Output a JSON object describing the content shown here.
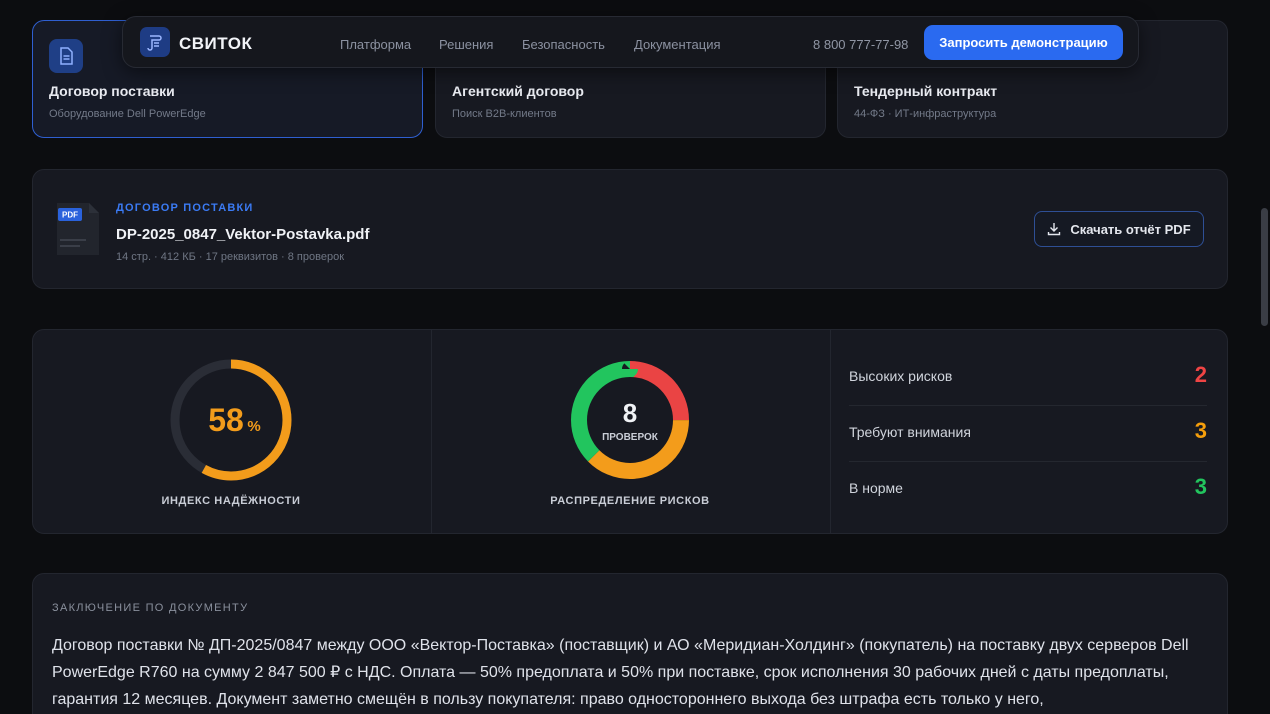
{
  "nav": {
    "brand": "СВИТОК",
    "links": [
      "Платформа",
      "Решения",
      "Безопасность",
      "Документация"
    ],
    "phone": "8 800 777-77-98",
    "cta": "Запросить демонстрацию"
  },
  "contract_tabs": [
    {
      "title": "Договор поставки",
      "subtitle": "Оборудование Dell PowerEdge",
      "active": true
    },
    {
      "title": "Агентский договор",
      "subtitle": "Поиск B2B-клиентов",
      "active": false
    },
    {
      "title": "Тендерный контракт",
      "subtitle": "44-ФЗ · ИТ-инфраструктура",
      "active": false
    }
  ],
  "file": {
    "badge": "PDF",
    "category": "ДОГОВОР ПОСТАВКИ",
    "name": "DP-2025_0847_Vektor-Postavka.pdf",
    "meta": "14 стр. · 412 КБ · 17 реквизитов · 8 проверок",
    "download_label": "Скачать отчёт PDF"
  },
  "stats": {
    "reliability": {
      "value": "58",
      "unit": "%",
      "fraction": 0.58,
      "label": "ИНДЕКС НАДЁЖНОСТИ",
      "color": "#f39c1b"
    },
    "distribution": {
      "total": "8",
      "total_label": "ПРОВЕРОК",
      "label": "РАСПРЕДЕЛЕНИЕ РИСКОВ",
      "segments": [
        {
          "count": 2,
          "color": "#ea4444"
        },
        {
          "count": 3,
          "color": "#f39c1b"
        },
        {
          "count": 3,
          "color": "#22c55e"
        }
      ]
    },
    "risks": [
      {
        "label": "Высоких рисков",
        "value": "2",
        "color": "#ef4444"
      },
      {
        "label": "Требуют внимания",
        "value": "3",
        "color": "#f59e0b"
      },
      {
        "label": "В норме",
        "value": "3",
        "color": "#22c55e"
      }
    ]
  },
  "conclusion": {
    "title": "ЗАКЛЮЧЕНИЕ ПО ДОКУМЕНТУ",
    "text": "Договор поставки № ДП-2025/0847 между ООО «Вектор-Поставка» (поставщик) и АО «Меридиан-Холдинг» (покупатель) на поставку двух серверов Dell PowerEdge R760 на сумму 2 847 500 ₽ с НДС. Оплата — 50% предоплата и 50% при поставке, срок исполнения 30 рабочих дней с даты предоплаты, гарантия 12 месяцев. Документ заметно смещён в пользу покупателя: право одностороннего выхода без штрафа есть только у него,"
  },
  "colors": {
    "accent": "#2a6af0",
    "track": "#2a2d36"
  }
}
